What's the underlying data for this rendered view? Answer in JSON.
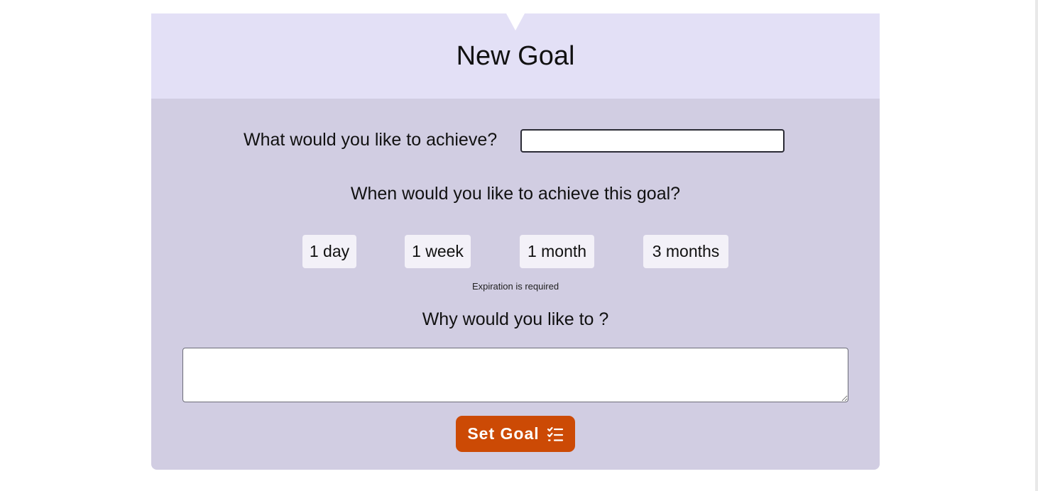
{
  "form": {
    "title": "New Goal",
    "achieve_label": "What would you like to achieve?",
    "achieve_value": "",
    "when_label": "When would you like to achieve this goal?",
    "expiration_options": [
      "1 day",
      "1 week",
      "1 month",
      "3 months"
    ],
    "expiration_error": "Expiration is required",
    "why_label": "Why would you like to ?",
    "why_value": "",
    "submit_label": "Set Goal",
    "submit_icon": "checklist-icon"
  },
  "colors": {
    "header_bg": "#e3e0f6",
    "body_bg": "#d1cde2",
    "option_bg": "#f3f1f8",
    "submit_bg": "#cc4a05"
  }
}
